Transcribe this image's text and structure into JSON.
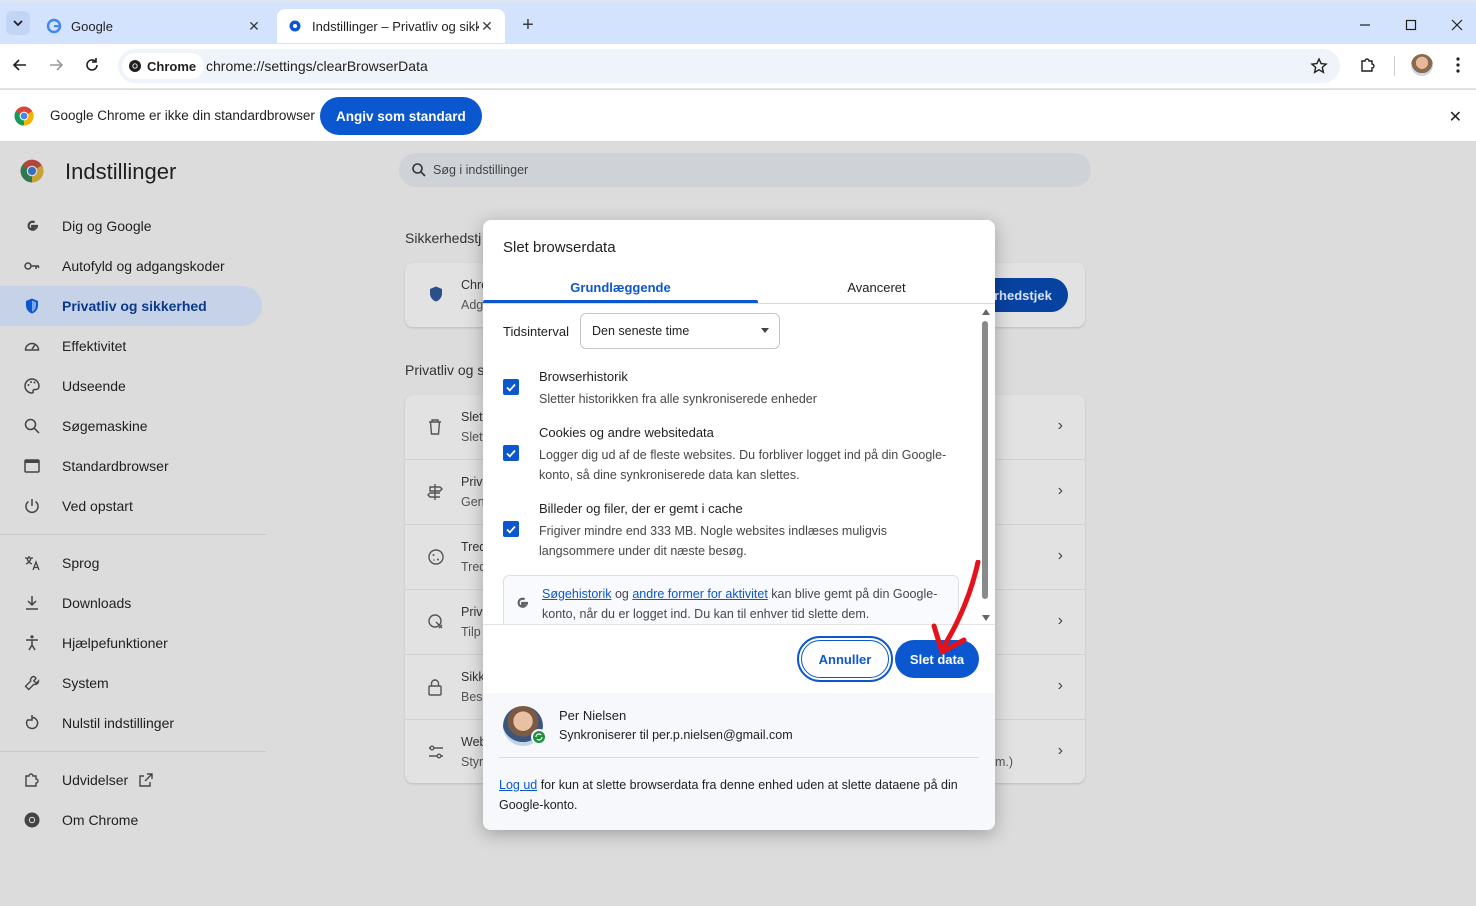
{
  "browser": {
    "tabs": [
      {
        "title": "Google",
        "active": false
      },
      {
        "title": "Indstillinger – Privatliv og sikkerhed",
        "active": true
      }
    ],
    "chip_label": "Chrome",
    "url": "chrome://settings/clearBrowserData"
  },
  "infobar": {
    "message": "Google Chrome er ikke din standardbrowser",
    "button": "Angiv som standard"
  },
  "settings": {
    "title": "Indstillinger",
    "search_placeholder": "Søg i indstillinger",
    "nav": [
      {
        "label": "Dig og Google",
        "icon": "google-g-icon"
      },
      {
        "label": "Autofyld og adgangskoder",
        "icon": "key-icon"
      },
      {
        "label": "Privatliv og sikkerhed",
        "icon": "shield-icon",
        "active": true
      },
      {
        "label": "Effektivitet",
        "icon": "speedometer-icon"
      },
      {
        "label": "Udseende",
        "icon": "palette-icon"
      },
      {
        "label": "Søgemaskine",
        "icon": "search-icon"
      },
      {
        "label": "Standardbrowser",
        "icon": "browser-window-icon"
      },
      {
        "label": "Ved opstart",
        "icon": "power-icon"
      }
    ],
    "nav2": [
      {
        "label": "Sprog",
        "icon": "translate-icon"
      },
      {
        "label": "Downloads",
        "icon": "download-icon"
      },
      {
        "label": "Hjælpefunktioner",
        "icon": "accessibility-icon"
      },
      {
        "label": "System",
        "icon": "wrench-icon"
      },
      {
        "label": "Nulstil indstillinger",
        "icon": "reset-icon"
      }
    ],
    "nav3": [
      {
        "label": "Udvidelser",
        "icon": "puzzle-icon"
      },
      {
        "label": "Om Chrome",
        "icon": "chrome-icon"
      }
    ],
    "section_safety": "Sikkerhedstj",
    "safety_card": {
      "line1": "Chro",
      "line2": "Adg",
      "button_fragment": "rhedstjek"
    },
    "section_privacy": "Privatliv og s",
    "privacy_rows": [
      {
        "l1": "Slet",
        "l2": "Slet"
      },
      {
        "l1": "Priv",
        "l2": "Gen"
      },
      {
        "l1": "Tred",
        "l2": "Tred"
      },
      {
        "l1": "Priv",
        "l2": "Tilp"
      },
      {
        "l1": "Sikk",
        "l2": "Besk"
      },
      {
        "l1": "Web",
        "l2": "Styr",
        "tail": "m.)"
      }
    ]
  },
  "dialog": {
    "title": "Slet browserdata",
    "tab_basic": "Grundlæggende",
    "tab_advanced": "Avanceret",
    "time_label": "Tidsinterval",
    "time_value": "Den seneste time",
    "options": [
      {
        "title": "Browserhistorik",
        "desc": "Sletter historikken fra alle synkroniserede enheder",
        "checked": true
      },
      {
        "title": "Cookies og andre websitedata",
        "desc": "Logger dig ud af de fleste websites. Du forbliver logget ind på din Google-konto, så dine synkroniserede data kan slettes.",
        "checked": true
      },
      {
        "title": "Billeder og filer, der er gemt i cache",
        "desc": "Frigiver mindre end 333 MB. Nogle websites indlæses muligvis langsommere under dit næste besøg.",
        "checked": true
      }
    ],
    "google_notice": {
      "link1": "Søgehistorik",
      "mid": " og ",
      "link2": "andre former for aktivitet",
      "rest": " kan blive gemt på din Google-konto, når du er logget ind. Du kan til enhver tid slette dem."
    },
    "cancel": "Annuller",
    "confirm": "Slet data",
    "account": {
      "name": "Per Nielsen",
      "sync": "Synkroniserer til per.p.nielsen@gmail.com"
    },
    "footer": {
      "link": "Log ud",
      "text": " for kun at slette browserdata fra denne enhed uden at slette dataene på din Google-konto."
    }
  },
  "colors": {
    "accent": "#0b57d0",
    "annotation_arrow": "#e3121b"
  }
}
